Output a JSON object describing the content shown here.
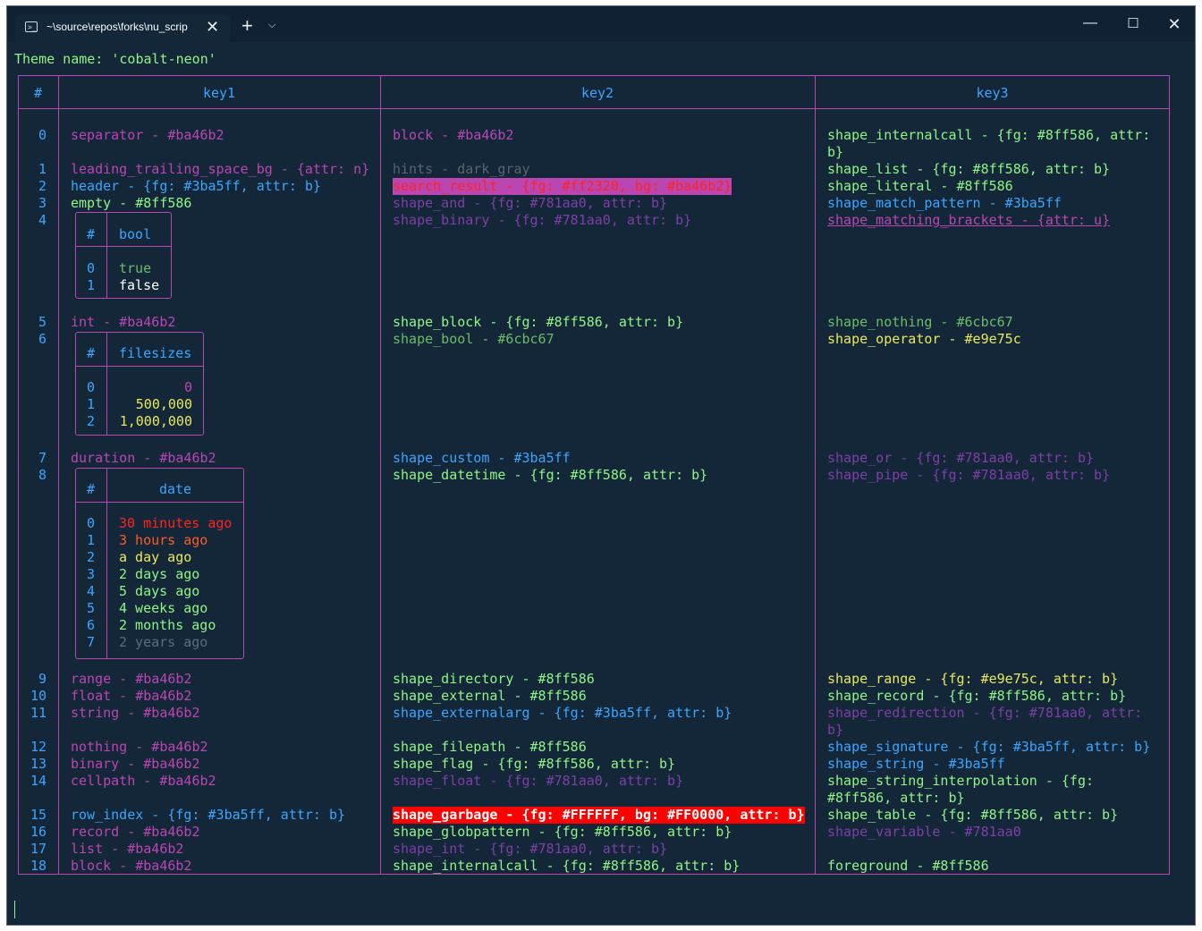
{
  "window": {
    "tab_title": "~\\source\\repos\\forks\\nu_scrip",
    "tab_icon": "terminal-icon",
    "controls": [
      "minimize-icon",
      "maximize-icon",
      "close-icon"
    ]
  },
  "terminal": {
    "theme_line": "Theme name: 'cobalt-neon'",
    "headers": {
      "index": "#",
      "key1": "key1",
      "key2": "key2",
      "key3": "key3"
    },
    "colors": {
      "border": "#ba46b2",
      "header": "#3ba5ff",
      "index": "#3ba5ff",
      "bg": "#132738"
    },
    "rows": [
      {
        "i": "0",
        "k1": "separator - #ba46b2",
        "k2": "block - #ba46b2",
        "k3": "shape_internalcall - {fg: #8ff586, attr:"
      },
      {
        "i": "1",
        "k1": "leading_trailing_space_bg - {attr: n}",
        "k2": "hints - dark_gray",
        "k3": "shape_list - {fg: #8ff586, attr: b}"
      },
      {
        "i": "2",
        "k1": "header - {fg: #3ba5ff, attr: b}",
        "k2": "search_result - {fg: #ff2320, bg: #ba46b2}",
        "k3": "shape_literal - #8ff586"
      },
      {
        "i": "3",
        "k1": "empty - #8ff586",
        "k2": "shape_and - {fg: #781aa0, attr: b}",
        "k3": "shape_match_pattern - #3ba5ff"
      },
      {
        "i": "4",
        "k1": "",
        "k2": "shape_binary - {fg: #781aa0, attr: b}",
        "k3": "shape_matching_brackets - {attr: u}"
      },
      {
        "i": "5",
        "k1": "int - #ba46b2",
        "k2": "shape_block - {fg: #8ff586, attr: b}",
        "k3": "shape_nothing - #6cbc67"
      },
      {
        "i": "6",
        "k1": "",
        "k2": "shape_bool - #6cbc67",
        "k3": "shape_operator - #e9e75c"
      },
      {
        "i": "7",
        "k1": "duration - #ba46b2",
        "k2": "shape_custom - #3ba5ff",
        "k3": "shape_or - {fg: #781aa0, attr: b}"
      },
      {
        "i": "8",
        "k1": "",
        "k2": "shape_datetime - {fg: #8ff586, attr: b}",
        "k3": "shape_pipe - {fg: #781aa0, attr: b}"
      },
      {
        "i": "9",
        "k1": "range - #ba46b2",
        "k2": "shape_directory - #8ff586",
        "k3": "shape_range - {fg: #e9e75c, attr: b}"
      },
      {
        "i": "10",
        "k1": "float - #ba46b2",
        "k2": "shape_external - #8ff586",
        "k3": "shape_record - {fg: #8ff586, attr: b}"
      },
      {
        "i": "11",
        "k1": "string - #ba46b2",
        "k2": "shape_externalarg - {fg: #3ba5ff, attr: b}",
        "k3": "shape_redirection - {fg: #781aa0, attr:"
      },
      {
        "i": "12",
        "k1": "nothing - #ba46b2",
        "k2": "shape_filepath - #8ff586",
        "k3": "shape_signature - {fg: #3ba5ff, attr: b}"
      },
      {
        "i": "13",
        "k1": "binary - #ba46b2",
        "k2": "shape_flag - {fg: #8ff586, attr: b}",
        "k3": "shape_string - #3ba5ff"
      },
      {
        "i": "14",
        "k1": "cellpath - #ba46b2",
        "k2": "shape_float - {fg: #781aa0, attr: b}",
        "k3": "shape_string_interpolation - {fg:"
      },
      {
        "i": "15",
        "k1": "row_index - {fg: #3ba5ff, attr: b}",
        "k2": "shape_garbage - {fg: #FFFFFF, bg: #FF0000, attr: b}",
        "k3": "shape_table - {fg: #8ff586, attr: b}"
      },
      {
        "i": "16",
        "k1": "record - #ba46b2",
        "k2": "shape_globpattern - {fg: #8ff586, attr: b}",
        "k3": "shape_variable - #781aa0"
      },
      {
        "i": "17",
        "k1": "list - #ba46b2",
        "k2": "shape_int - {fg: #781aa0, attr: b}",
        "k3": ""
      },
      {
        "i": "18",
        "k1": "block - #ba46b2",
        "k2": "shape_internalcall - {fg: #8ff586, attr: b}",
        "k3": "foreground - #8ff586"
      }
    ],
    "wrap_lines": {
      "row0_k3": "b}",
      "row11_k3": "b}",
      "row14_k3": "#8ff586, attr: b}"
    },
    "bool_table": {
      "header_idx": "#",
      "header": "bool",
      "rows": [
        {
          "i": "0",
          "v": "true"
        },
        {
          "i": "1",
          "v": "false"
        }
      ]
    },
    "filesize_table": {
      "header_idx": "#",
      "header": "filesizes",
      "rows": [
        {
          "i": "0",
          "v": "0"
        },
        {
          "i": "1",
          "v": "500,000"
        },
        {
          "i": "2",
          "v": "1,000,000"
        }
      ]
    },
    "date_table": {
      "header_idx": "#",
      "header": "date",
      "rows": [
        {
          "i": "0",
          "v": "30 minutes ago",
          "color": "#ff2320"
        },
        {
          "i": "1",
          "v": "3 hours ago",
          "color": "#ff5a2a"
        },
        {
          "i": "2",
          "v": "a day ago",
          "color": "#e9e75c"
        },
        {
          "i": "3",
          "v": "2 days ago",
          "color": "#8ff586"
        },
        {
          "i": "4",
          "v": "5 days ago",
          "color": "#8ff586"
        },
        {
          "i": "5",
          "v": "4 weeks ago",
          "color": "#8ff586"
        },
        {
          "i": "6",
          "v": "2 months ago",
          "color": "#8ff586"
        },
        {
          "i": "7",
          "v": "2 years ago",
          "color": "#5e6b78"
        }
      ]
    }
  }
}
